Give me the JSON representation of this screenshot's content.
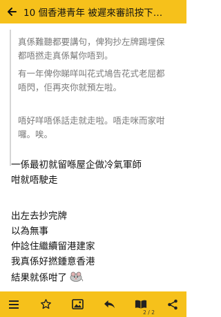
{
  "header": {
    "title": "10 個香港青年 被遲來審訊按下…"
  },
  "quote": {
    "lines": [
      "真係難聽都要講句，俾狗抄左牌踢埋保",
      "都唔撚走真係幫你唔到。",
      "有一年俾你睇咩叫花式鳩告花式老屈都",
      "唔閃，佢再夾你就預左啦。",
      "",
      "唔好咩唔係話走就走啦。唔走咪而家咁",
      "囉。唉。"
    ]
  },
  "post": {
    "lines": [
      "一係最初就留喺屋企做冷氣軍師",
      "咁就唔駛走",
      "",
      "出左去抄完牌",
      "以為無事",
      "仲諗住繼續留港建家",
      "我真係好撚鍾意香港",
      "結果就係咁了"
    ]
  },
  "toolbar": {
    "page_indicator": "2 / 2"
  },
  "colors": {
    "accent": "#f6c11b",
    "quote_text": "#7a7a7a"
  },
  "icons": [
    "arrow-left-icon",
    "menu-icon",
    "star-icon",
    "image-icon",
    "reply-icon",
    "book-icon",
    "share-icon",
    "mouse-emoji"
  ]
}
